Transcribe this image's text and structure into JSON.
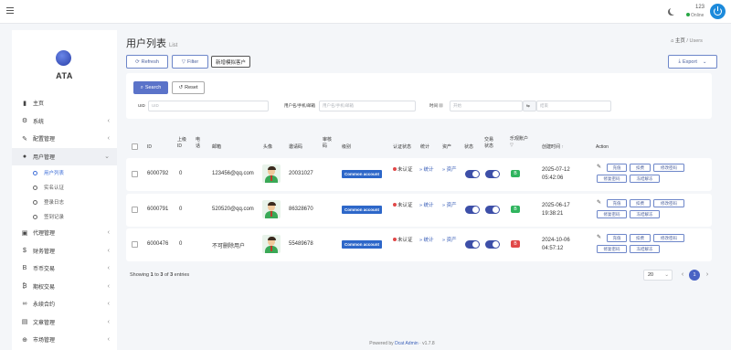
{
  "topbar": {
    "username": "123",
    "status": "Online"
  },
  "sidebar": {
    "logo": "ATA",
    "items": [
      {
        "label": "主页",
        "icon": "bar-chart-icon"
      },
      {
        "label": "系统",
        "icon": "gear-icon"
      },
      {
        "label": "配置管理",
        "icon": "wrench-icon"
      },
      {
        "label": "用户管理",
        "icon": "user-icon"
      },
      {
        "label": "代理管理",
        "icon": "id-card-icon"
      },
      {
        "label": "财务管理",
        "icon": "dollar-icon"
      },
      {
        "label": "币币交易",
        "icon": "bitcoin-icon"
      },
      {
        "label": "期权交易",
        "icon": "options-icon"
      },
      {
        "label": "永续合约",
        "icon": "link-icon"
      },
      {
        "label": "文章管理",
        "icon": "newspaper-icon"
      },
      {
        "label": "市场管理",
        "icon": "globe-icon"
      }
    ],
    "sub_items": [
      "用户列表",
      "实名认证",
      "登录日志",
      "签到记录"
    ]
  },
  "header": {
    "title": "用户列表",
    "subtitle": "List",
    "breadcrumb_home": "主页",
    "breadcrumb_current": "Users"
  },
  "toolbar": {
    "refresh": "Refresh",
    "filter": "Filter",
    "add_test": "新增模拟客户",
    "export": "Export"
  },
  "filter": {
    "search": "Search",
    "reset": "Reset",
    "uid_label": "UID",
    "uid_placeholder": "UID",
    "name_label": "用户名/手机/邮箱",
    "name_placeholder": "用户名/手机/邮箱",
    "time_label": "时间",
    "time_from": "开始",
    "time_to": "结束"
  },
  "table": {
    "headers": [
      "ID",
      "上级ID",
      "电话",
      "邮箱",
      "头像",
      "邀请码",
      "审核码",
      "级别",
      "认证状态",
      "统计",
      "资产",
      "状态",
      "交易状态",
      "乐观账户",
      "创建时间",
      "Action"
    ],
    "rows": [
      {
        "id": "6000792",
        "parent": "0",
        "phone": "",
        "email": "123456@qq.com",
        "invite": "20031027",
        "level": "Common account",
        "auth": "未认证",
        "stats": "» 统计",
        "assets": "» 资产",
        "badge": "B",
        "created": "2025-07-12 05:42:06"
      },
      {
        "id": "6000791",
        "parent": "0",
        "phone": "",
        "email": "520520@qq.com",
        "invite": "86328670",
        "level": "Common account",
        "auth": "未认证",
        "stats": "» 统计",
        "assets": "» 资产",
        "badge": "B",
        "created": "2025-06-17 19:38:21"
      },
      {
        "id": "6000476",
        "parent": "0",
        "phone": "",
        "email": "不可删除用户",
        "invite": "55489678",
        "level": "Common account",
        "auth": "未认证",
        "stats": "» 统计",
        "assets": "» 资产",
        "badge": "B",
        "created": "2024-10-06 04:57:12"
      }
    ],
    "actions": [
      "充值",
      "扣费",
      "修改密码",
      "修复密码",
      "冻结解冻"
    ]
  },
  "footer": {
    "showing_pre": "Showing",
    "from": "1",
    "to_word": "to",
    "to": "3",
    "of_word": "of",
    "total": "3",
    "entries": "entries",
    "page_size": "20",
    "current_page": "1"
  },
  "powered": {
    "prefix": "Powered by",
    "name": "Dcat Admin",
    "version": "· v1.7.8"
  }
}
